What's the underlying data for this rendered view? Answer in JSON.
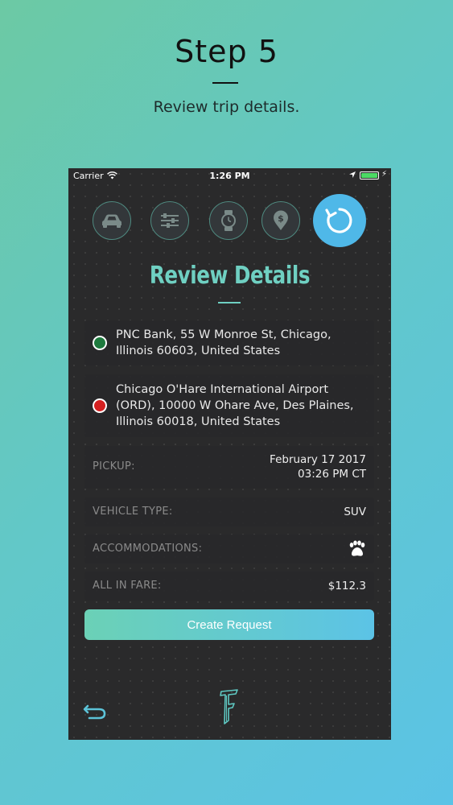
{
  "promo": {
    "title": "Step 5",
    "subtitle": "Review trip details."
  },
  "status_bar": {
    "carrier": "Carrier",
    "time": "1:26 PM"
  },
  "steps": [
    {
      "icon": "car-icon"
    },
    {
      "icon": "sliders-icon"
    },
    {
      "icon": "watch-icon"
    },
    {
      "icon": "dollar-pin-icon"
    },
    {
      "icon": "refresh-icon",
      "active": true
    }
  ],
  "review": {
    "heading": "Review Details",
    "pickup_address": "PNC Bank, 55 W Monroe St, Chicago, Illinois 60603, United States",
    "dropoff_address": "Chicago O'Hare International Airport (ORD), 10000 W Ohare Ave, Des Plaines, Illinois 60018, United States",
    "pickup_label": "PICKUP:",
    "pickup_date": "February 17 2017",
    "pickup_time": "03:26 PM CT",
    "vehicle_label": "VEHICLE TYPE:",
    "vehicle_value": "SUV",
    "accommodations_label": "ACCOMMODATIONS:",
    "accommodations_icon": "paw-icon",
    "fare_label": "ALL IN FARE:",
    "fare_value": "$112.3",
    "create_button": "Create Request"
  },
  "colors": {
    "accent": "#6fd0c2",
    "active_step": "#4fb8e8",
    "pickup_dot": "#1e7a3e",
    "dropoff_dot": "#d42020"
  }
}
